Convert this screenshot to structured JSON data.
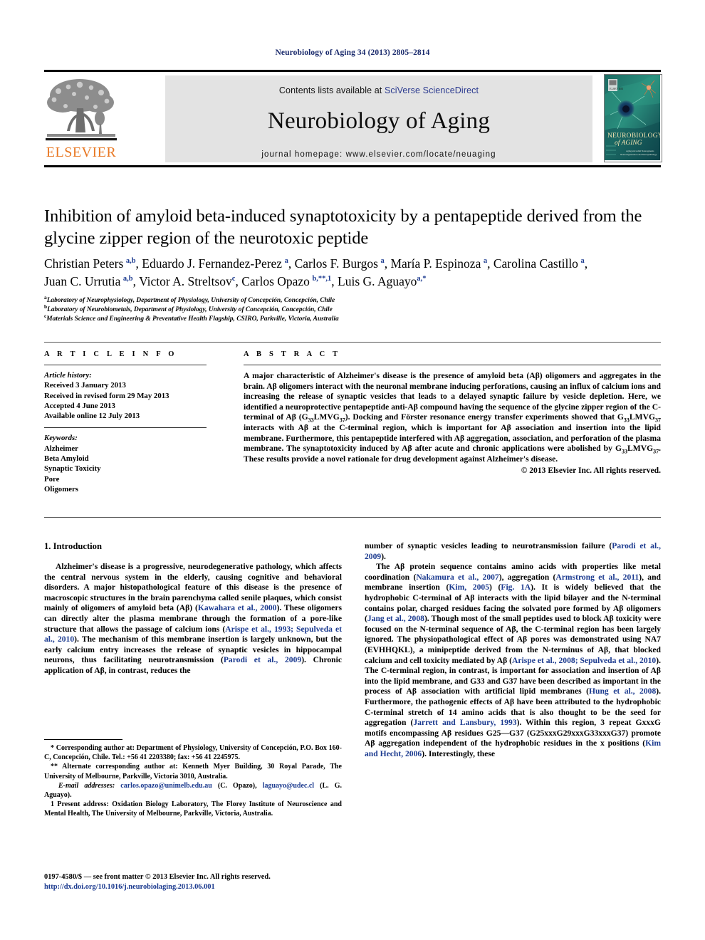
{
  "running_head": "Neurobiology of Aging 34 (2013) 2805–2814",
  "masthead": {
    "contents_prefix": "Contents lists available at ",
    "contents_link": "SciVerse ScienceDirect",
    "journal_title": "Neurobiology of Aging",
    "homepage": "journal homepage: www.elsevier.com/locate/neuaging",
    "publisher_word": "ELSEVIER",
    "cover_title_line1": "NEUROBIOLOGY",
    "cover_title_line2": "of AGING",
    "cover_sub1": "Aging and Adult Neurogenesis",
    "cover_sub2": "Neurodegeneration and Neuropathology"
  },
  "article": {
    "title": "Inhibition of amyloid beta-induced synaptotoxicity by a pentapeptide derived from the glycine zipper region of the neurotoxic peptide",
    "authors_line1": "Christian Peters a,b, Eduardo J. Fernandez-Perez a, Carlos F. Burgos a, María P. Espinoza a, Carolina Castillo a,",
    "authors_line2": "Juan C. Urrutia a,b, Victor A. Streltsov c, Carlos Opazo b,**,1, Luis G. Aguayo a,*",
    "affiliations": [
      {
        "mark": "a",
        "text": "Laboratory of Neurophysiology, Department of Physiology, University of Concepción, Concepción, Chile"
      },
      {
        "mark": "b",
        "text": "Laboratory of Neurobiometals, Department of Physiology, University of Concepción, Concepción, Chile"
      },
      {
        "mark": "c",
        "text": "Materials Science and Engineering & Preventative Health Flagship, CSIRO, Parkville, Victoria, Australia"
      }
    ]
  },
  "article_info": {
    "heading": "A R T I C L E  I N F O",
    "history_label": "Article history:",
    "history": [
      "Received 3 January 2013",
      "Received in revised form 29 May 2013",
      "Accepted 4 June 2013",
      "Available online 12 July 2013"
    ],
    "keywords_label": "Keywords:",
    "keywords": [
      "Alzheimer",
      "Beta Amyloid",
      "Synaptic Toxicity",
      "Pore",
      "Oligomers"
    ]
  },
  "abstract": {
    "heading": "A B S T R A C T",
    "text": "A major characteristic of Alzheimer's disease is the presence of amyloid beta (Aβ) oligomers and aggregates in the brain. Aβ oligomers interact with the neuronal membrane inducing perforations, causing an influx of calcium ions and increasing the release of synaptic vesicles that leads to a delayed synaptic failure by vesicle depletion. Here, we identified a neuroprotective pentapeptide anti-Aβ compound having the sequence of the glycine zipper region of the C-terminal of Aβ (G33LMVG37). Docking and Förster resonance energy transfer experiments showed that G33LMVG37 interacts with Aβ at the C-terminal region, which is important for Aβ association and insertion into the lipid membrane. Furthermore, this pentapeptide interfered with Aβ aggregation, association, and perforation of the plasma membrane. The synaptotoxicity induced by Aβ after acute and chronic applications were abolished by G33LMVG37. These results provide a novel rationale for drug development against Alzheimer's disease.",
    "copyright": "© 2013 Elsevier Inc. All rights reserved."
  },
  "body": {
    "section_title": "1. Introduction",
    "left_p1": "Alzheimer's disease is a progressive, neurodegenerative pathology, which affects the central nervous system in the elderly, causing cognitive and behavioral disorders. A major histopathological feature of this disease is the presence of macroscopic structures in the brain parenchyma called senile plaques, which consist mainly of oligomers of amyloid beta (Aβ) (Kawahara et al., 2000). These oligomers can directly alter the plasma membrane through the formation of a pore-like structure that allows the passage of calcium ions (Arispe et al., 1993; Sepulveda et al., 2010). The mechanism of this membrane insertion is largely unknown, but the early calcium entry increases the release of synaptic vesicles in hippocampal neurons, thus facilitating neurotransmission (Parodi et al., 2009). Chronic application of Aβ, in contrast, reduces the",
    "right_p1": "number of synaptic vesicles leading to neurotransmission failure (Parodi et al., 2009).",
    "right_p2": "The Aβ protein sequence contains amino acids with properties like metal coordination (Nakamura et al., 2007), aggregation (Armstrong et al., 2011), and membrane insertion (Kim, 2005) (Fig. 1A). It is widely believed that the hydrophobic C-terminal of Aβ interacts with the lipid bilayer and the N-terminal contains polar, charged residues facing the solvated pore formed by Aβ oligomers (Jang et al., 2008). Though most of the small peptides used to block Aβ toxicity were focused on the N-terminal sequence of Aβ, the C-terminal region has been largely ignored. The physiopathological effect of Aβ pores was demonstrated using NA7 (EVHHQKL), a minipeptide derived from the N-terminus of Aβ, that blocked calcium and cell toxicity mediated by Aβ (Arispe et al., 2008; Sepulveda et al., 2010). The C-terminal region, in contrast, is important for association and insertion of Aβ into the lipid membrane, and G33 and G37 have been described as important in the process of Aβ association with artificial lipid membranes (Hung et al., 2008). Furthermore, the pathogenic effects of Aβ have been attributed to the hydrophobic C-terminal stretch of 14 amino acids that is also thought to be the seed for aggregation (Jarrett and Lansbury, 1993). Within this region, 3 repeat GxxxG motifs encompassing Aβ residues G25—G37 (G25xxxG29xxxG33xxxG37) promote Aβ aggregation independent of the hydrophobic residues in the x positions (Kim and Hecht, 2006). Interestingly, these"
  },
  "footnotes": {
    "corresponding": "* Corresponding author at: Department of Physiology, University of Concepción, P.O. Box 160-C, Concepción, Chile. Tel.: +56 41 2203380; fax: +56 41 2245975.",
    "alternate": "** Alternate corresponding author at: Kenneth Myer Building, 30 Royal Parade, The University of Melbourne, Parkville, Victoria 3010, Australia.",
    "email_label": "E-mail addresses:",
    "email1": "carlos.opazo@unimelb.edu.au",
    "email1_owner": "(C. Opazo),",
    "email2": "laguayo@udec.cl",
    "email2_owner": "(L. G. Aguayo).",
    "present_address": "1 Present address: Oxidation Biology Laboratory, The Florey Institute of Neuroscience and Mental Health, The University of Melbourne, Parkville, Victoria, Australia.",
    "imprint": "0197-4580/$ — see front matter © 2013 Elsevier Inc. All rights reserved.",
    "doi": "http://dx.doi.org/10.1016/j.neurobiolaging.2013.06.001"
  },
  "colors": {
    "link": "#1b3a8f",
    "elsevier_orange": "#e87722",
    "masthead_bg": "#e3e3e3"
  }
}
